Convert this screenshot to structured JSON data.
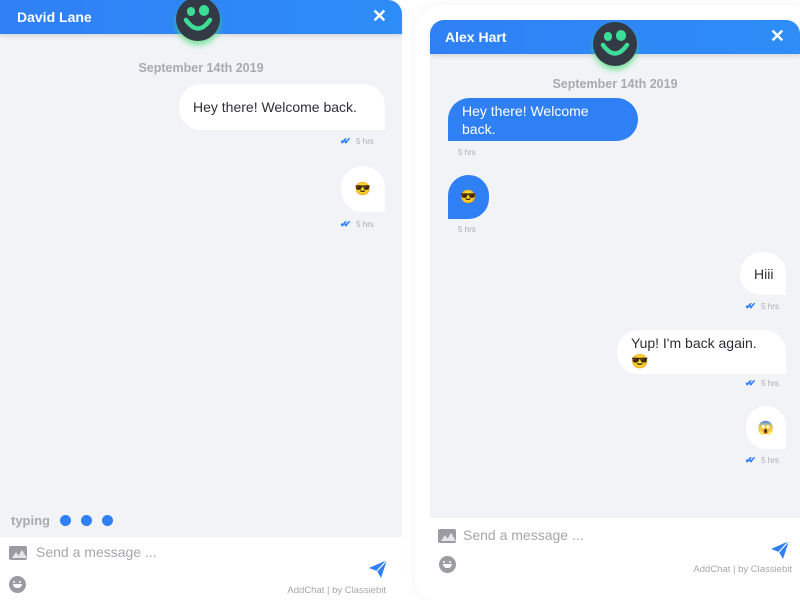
{
  "left_chat": {
    "contact_name": "David Lane",
    "close_label": "✕",
    "date_label": "September 14th 2019",
    "messages": [
      {
        "direction": "incoming",
        "text": "Hey there! Welcome back.",
        "time": "5 hrs",
        "read_icon": "double-check-icon"
      },
      {
        "direction": "incoming",
        "text": "😎",
        "time": "5 hrs",
        "read_icon": "double-check-icon"
      }
    ],
    "typing": {
      "label": "typing",
      "dots": 3
    },
    "composer": {
      "placeholder": "Send a message ...",
      "value": "",
      "attach_icon": "image-icon",
      "emoji_icon": "smiley-icon",
      "send_icon": "paper-plane-icon",
      "branding": "AddChat | by Classiebit"
    }
  },
  "right_chat": {
    "contact_name": "Alex Hart",
    "close_label": "✕",
    "date_label": "September 14th 2019",
    "messages": [
      {
        "direction": "outgoing",
        "text": "Hey there! Welcome back.",
        "time": "5 hrs"
      },
      {
        "direction": "outgoing",
        "text": "😎",
        "time": "5 hrs"
      },
      {
        "direction": "incoming",
        "text": "Hiii",
        "time": "5 hrs",
        "read_icon": "double-check-icon"
      },
      {
        "direction": "incoming",
        "text": "Yup! I'm back again. 😎",
        "time": "5 hrs",
        "read_icon": "double-check-icon"
      },
      {
        "direction": "incoming",
        "text": "😱",
        "time": "5 hrs",
        "read_icon": "double-check-icon"
      }
    ],
    "composer": {
      "placeholder": "Send a message ...",
      "value": "",
      "attach_icon": "image-icon",
      "emoji_icon": "smiley-icon",
      "send_icon": "paper-plane-icon",
      "branding": "AddChat | by Classiebit"
    }
  },
  "theme": {
    "accent": "#2f80f5",
    "background": "#f2f3f7",
    "avatar_bg": "#333a46",
    "avatar_face": "#3ddc97",
    "muted_text": "#a8aab0"
  }
}
